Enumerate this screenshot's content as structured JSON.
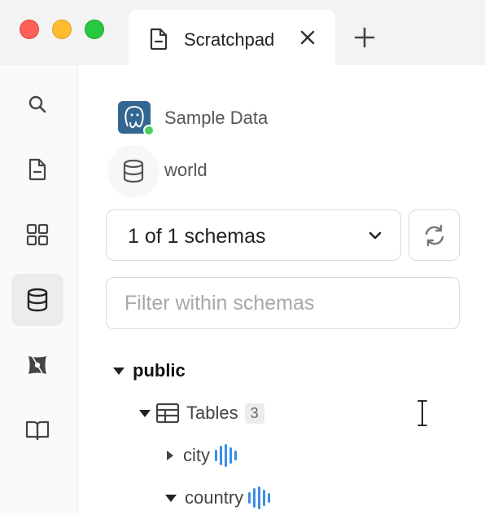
{
  "window": {
    "tab": {
      "label": "Scratchpad",
      "icon": "document-icon"
    }
  },
  "sidebar": {
    "items": [
      {
        "name": "search",
        "icon": "search-icon"
      },
      {
        "name": "scratchpad",
        "icon": "document-icon"
      },
      {
        "name": "dashboards",
        "icon": "grid-icon"
      },
      {
        "name": "databases",
        "icon": "database-icon",
        "active": true
      },
      {
        "name": "dbt",
        "icon": "dbt-icon"
      },
      {
        "name": "docs",
        "icon": "book-icon"
      }
    ]
  },
  "connection": {
    "name": "Sample Data",
    "status": "connected",
    "status_color": "#4ccf5a",
    "database": "world"
  },
  "schema_select": {
    "value": "1 of 1 schemas"
  },
  "filter": {
    "placeholder": "Filter within schemas",
    "value": ""
  },
  "tree": {
    "schema": "public",
    "tables_label": "Tables",
    "tables_count": "3",
    "tables": [
      {
        "name": "city",
        "expanded": false
      },
      {
        "name": "country",
        "expanded": true
      }
    ]
  },
  "colors": {
    "accent_blue": "#3a8ee6",
    "postgres_blue": "#336791"
  }
}
